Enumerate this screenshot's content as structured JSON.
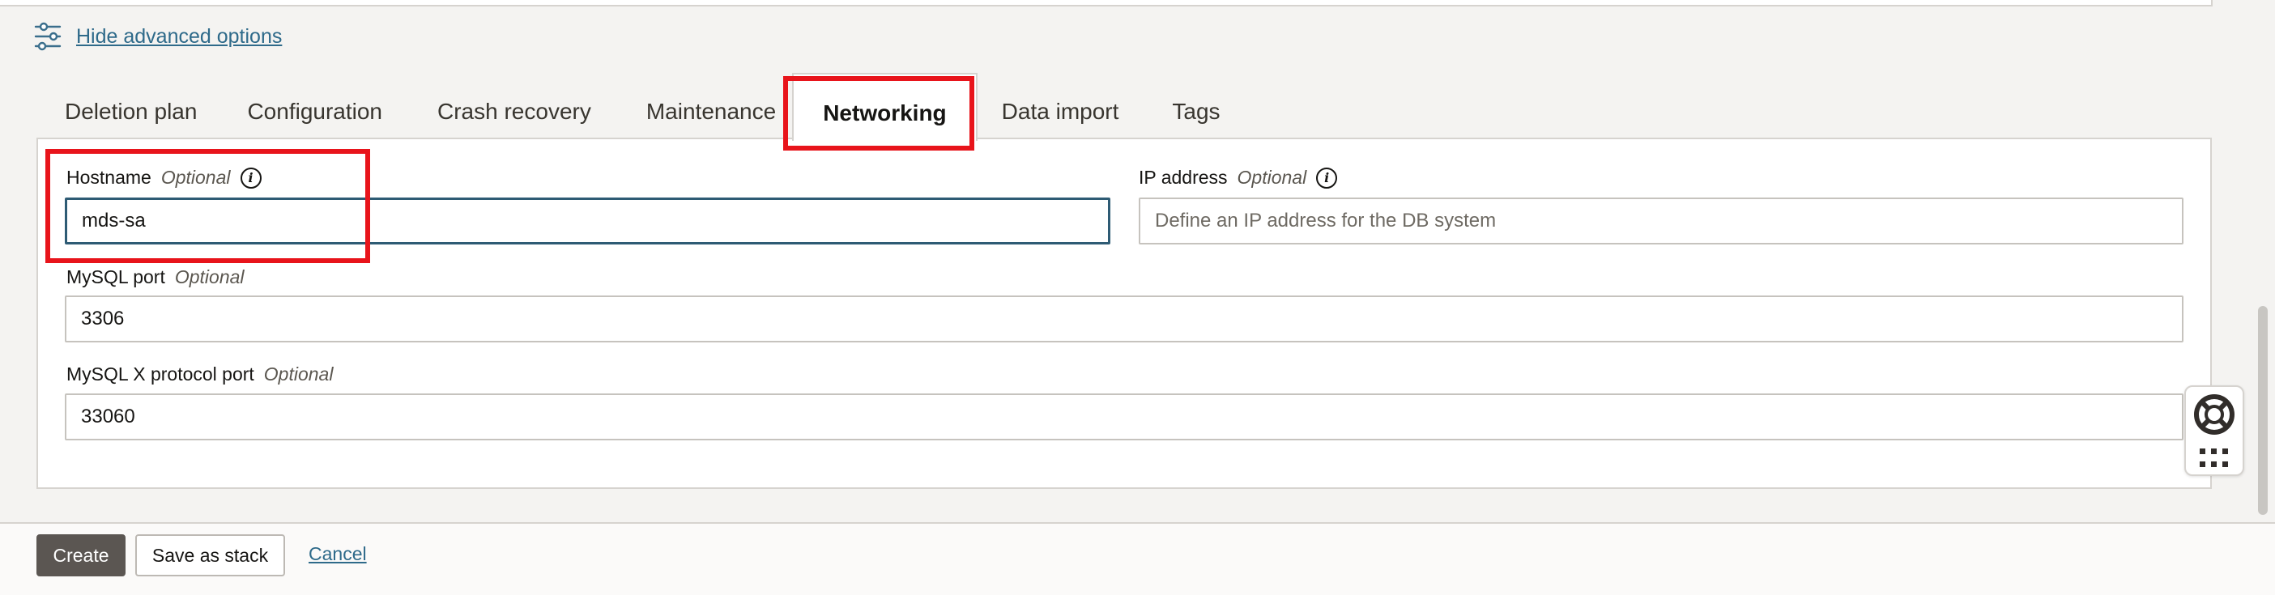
{
  "advanced": {
    "label": "Hide advanced options",
    "icon": "sliders-icon"
  },
  "tabs": [
    {
      "label": "Deletion plan",
      "active": false
    },
    {
      "label": "Configuration",
      "active": false
    },
    {
      "label": "Crash recovery",
      "active": false
    },
    {
      "label": "Maintenance",
      "active": false
    },
    {
      "label": "Networking",
      "active": true
    },
    {
      "label": "Data import",
      "active": false
    },
    {
      "label": "Tags",
      "active": false
    }
  ],
  "networking": {
    "hostname": {
      "label": "Hostname",
      "optional": "Optional",
      "value": "mds-sa",
      "info_icon": "info-icon"
    },
    "ip_address": {
      "label": "IP address",
      "optional": "Optional",
      "value": "",
      "placeholder": "Define an IP address for the DB system",
      "info_icon": "info-icon"
    },
    "mysql_port": {
      "label": "MySQL port",
      "optional": "Optional",
      "value": "3306"
    },
    "mysqlx_port": {
      "label": "MySQL X protocol port",
      "optional": "Optional",
      "value": "33060"
    }
  },
  "footer": {
    "create": "Create",
    "save_stack": "Save as stack",
    "cancel": "Cancel"
  },
  "help_widget": {
    "icons": [
      "lifebuoy-icon",
      "apps-grid-icon"
    ]
  },
  "colors": {
    "highlight": "#e8141b",
    "link": "#2e6a8a",
    "primary_button": "#5b5652",
    "focus_border": "#2e5b74"
  }
}
